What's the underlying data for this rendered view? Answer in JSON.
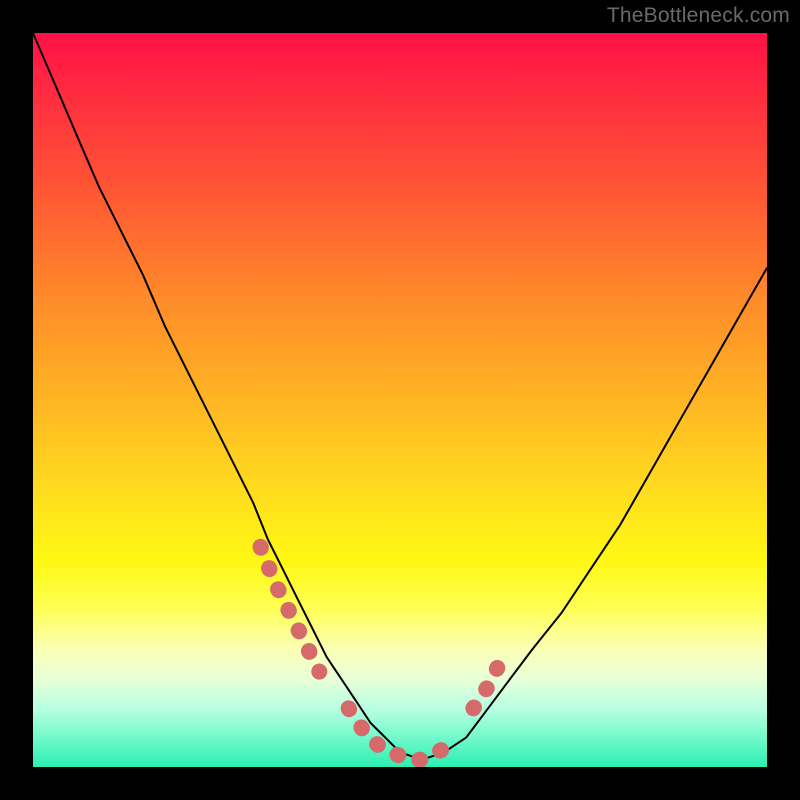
{
  "watermark": {
    "text": "TheBottleneck.com"
  },
  "chart_data": {
    "type": "line",
    "title": "",
    "xlabel": "",
    "ylabel": "",
    "xlim": [
      0,
      100
    ],
    "ylim": [
      0,
      100
    ],
    "grid": false,
    "legend": false,
    "series": [
      {
        "name": "bottleneck-curve",
        "color": "#000000",
        "x": [
          0,
          3,
          6,
          9,
          12,
          15,
          18,
          21,
          24,
          27,
          30,
          32,
          34,
          36,
          38,
          40,
          42,
          44,
          46,
          48,
          50,
          53,
          56,
          59,
          62,
          65,
          68,
          72,
          76,
          80,
          84,
          88,
          92,
          96,
          100
        ],
        "values": [
          100,
          93,
          86,
          79,
          73,
          67,
          60,
          54,
          48,
          42,
          36,
          31,
          27,
          23,
          19,
          15,
          12,
          9,
          6,
          4,
          2,
          1,
          2,
          4,
          8,
          12,
          16,
          21,
          27,
          33,
          40,
          47,
          54,
          61,
          68
        ]
      },
      {
        "name": "highlight-segments",
        "color": "#d66a6a",
        "segments": [
          {
            "x": [
              31,
              33,
              35,
              37,
              39
            ],
            "values": [
              30,
              25,
              21,
              17,
              13
            ]
          },
          {
            "x": [
              43,
              45,
              47,
              49,
              51,
              53,
              55,
              57
            ],
            "values": [
              8,
              5,
              3,
              2,
              1,
              1,
              2,
              3
            ]
          },
          {
            "x": [
              60,
              62,
              64
            ],
            "values": [
              8,
              11,
              15
            ]
          }
        ]
      }
    ]
  }
}
